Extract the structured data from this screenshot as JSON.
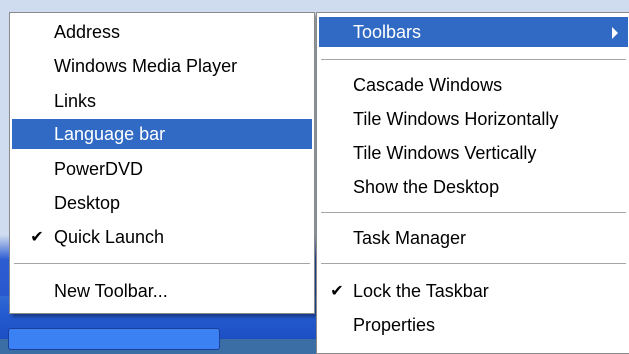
{
  "toolbars_submenu": {
    "items": [
      {
        "label": "Address",
        "checked": false
      },
      {
        "label": "Windows Media Player",
        "checked": false
      },
      {
        "label": "Links",
        "checked": false
      },
      {
        "label": "Language bar",
        "checked": false,
        "selected": true
      },
      {
        "label": "PowerDVD",
        "checked": false
      },
      {
        "label": "Desktop",
        "checked": false
      },
      {
        "label": "Quick Launch",
        "checked": true
      }
    ],
    "new_toolbar_label": "New Toolbar..."
  },
  "taskbar_context_menu": {
    "toolbars_label": "Toolbars",
    "cascade_label": "Cascade Windows",
    "tile_horizontal_label": "Tile Windows Horizontally",
    "tile_vertical_label": "Tile Windows Vertically",
    "show_desktop_label": "Show the Desktop",
    "task_manager_label": "Task Manager",
    "lock_taskbar_label": "Lock the Taskbar",
    "lock_taskbar_checked": true,
    "properties_label": "Properties"
  },
  "glyphs": {
    "check": "✔"
  },
  "colors": {
    "selection": "#316ac5",
    "menu_background": "#ffffff",
    "taskbar": "#245bd0"
  }
}
